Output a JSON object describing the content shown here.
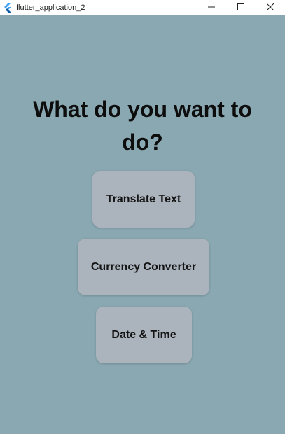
{
  "window": {
    "title": "flutter_application_2",
    "icon": "flutter-logo-icon",
    "controls": {
      "minimize_icon": "minimize-icon",
      "maximize_icon": "maximize-icon",
      "close_icon": "close-icon"
    }
  },
  "main": {
    "heading": "What do you want to do?",
    "buttons": {
      "translate": "Translate Text",
      "currency": "Currency Converter",
      "datetime": "Date & Time"
    }
  },
  "colors": {
    "background": "#8aa8b2",
    "button": "#abb4bd",
    "flutter_blue": "#42a5f5"
  }
}
